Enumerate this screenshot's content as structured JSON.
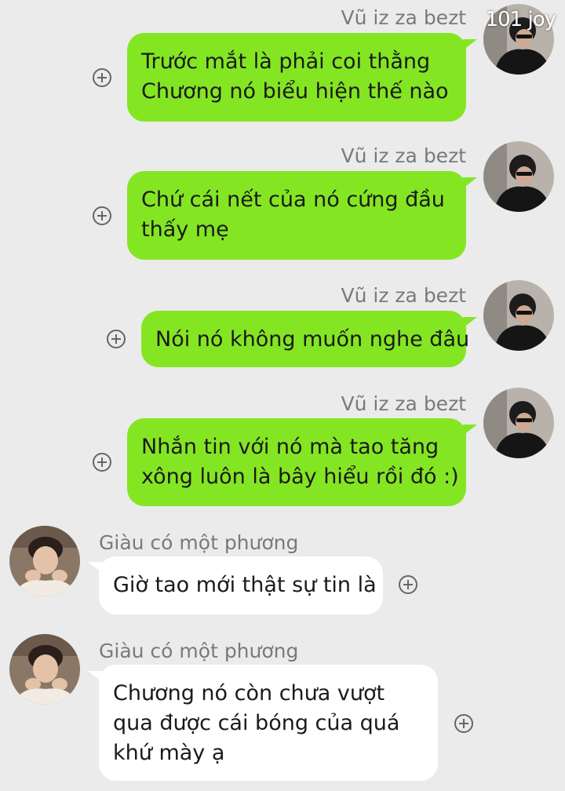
{
  "watermark": "101 joy",
  "colors": {
    "sent_bubble": "#84e623",
    "received_bubble": "#ffffff",
    "background": "#ebebeb",
    "sender_name": "#7a7a7a"
  },
  "messages": [
    {
      "sender": "Vũ iz za bezt",
      "side": "right",
      "lines": [
        "Trước mắt là phải coi thằng",
        "Chương nó biểu hiện thế nào"
      ],
      "action_icon": "add-reaction-icon"
    },
    {
      "sender": "Vũ iz za bezt",
      "side": "right",
      "lines": [
        "Chứ cái nết của nó cứng đầu",
        "thấy mẹ"
      ],
      "action_icon": "add-reaction-icon"
    },
    {
      "sender": "Vũ iz za bezt",
      "side": "right",
      "lines": [
        "Nói nó không muốn nghe đâu"
      ],
      "action_icon": "add-reaction-icon"
    },
    {
      "sender": "Vũ iz za bezt",
      "side": "right",
      "lines": [
        "Nhắn tin với nó mà tao tăng",
        "xông luôn là bây hiểu rồi đó :)"
      ],
      "action_icon": "add-reaction-icon"
    },
    {
      "sender": "Giàu có một phương",
      "side": "left",
      "lines": [
        "Giờ tao mới thật sự tin là"
      ],
      "action_icon": "add-reaction-icon"
    },
    {
      "sender": "Giàu có một phương",
      "side": "left",
      "lines": [
        "Chương nó còn chưa vượt",
        "qua được cái bóng của quá",
        "khứ mày ạ"
      ],
      "action_icon": "add-reaction-icon"
    }
  ]
}
